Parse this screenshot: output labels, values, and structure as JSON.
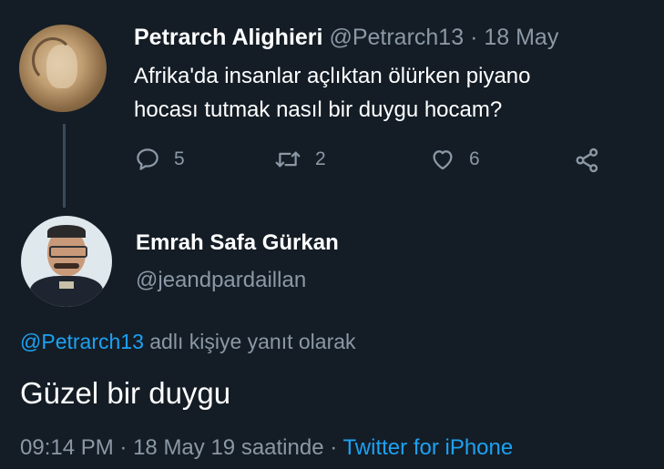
{
  "original_tweet": {
    "author_name": "Petrarch Alighieri",
    "author_handle": "@Petrarch13",
    "separator": "·",
    "date": "18 May",
    "text_line1": "Afrika'da insanlar açlıktan ölürken piyano",
    "text_line2": "hocası tutmak nasıl bir duygu hocam?",
    "reply_count": "5",
    "retweet_count": "2",
    "like_count": "6"
  },
  "reply_tweet": {
    "author_name": "Emrah Safa Gürkan",
    "author_handle": "@jeandpardaillan",
    "reply_to_mention": "@Petrarch13",
    "reply_to_suffix": " adlı kişiye yanıt olarak",
    "text": "Güzel bir duygu",
    "time": "09:14 PM",
    "separator": "·",
    "date_suffix": "18 May 19 saatinde",
    "source": "Twitter for iPhone"
  },
  "colors": {
    "background": "#141d26",
    "secondary_text": "#8b98a5",
    "link": "#1da1f2"
  }
}
